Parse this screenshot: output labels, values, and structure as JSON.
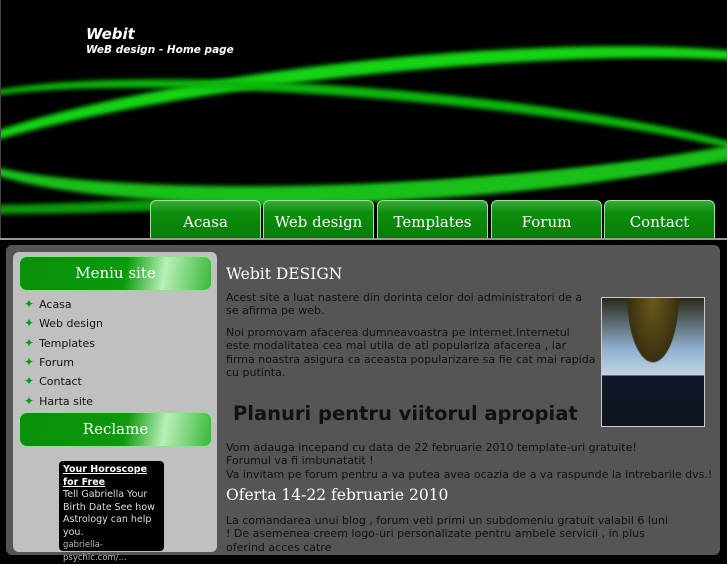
{
  "header": {
    "title": "Webit",
    "subtitle": "WeB design - Home page"
  },
  "nav": [
    "Acasa",
    "Web design",
    "Templates",
    "Forum",
    "Contact"
  ],
  "sidebar": {
    "menu_title": "Meniu site",
    "menu": [
      "Acasa",
      "Web design",
      "Templates",
      "Forum",
      "Contact",
      "Harta site"
    ],
    "ads_title": "Reclame",
    "ad": {
      "title": "Your Horoscope for Free",
      "text": "Tell Gabriella Your Birth Date See how Astrology can help you.",
      "url": "gabriella-psychic.com/..."
    }
  },
  "content": {
    "h1": "Webit DESIGN",
    "p1": "Acest site a luat nastere din dorinta celor doi administratori de a se afirma pe web.",
    "p2": "Noi promovam afacerea dumneavoastra pe internet.Internetul este modalitatea cea mai utila de ati populariza afacerea , iar firma noastra asigura ca aceasta popularizare sa fie cat mai rapida cu putinta.",
    "h2": "Planuri pentru viitorul apropiat",
    "lines": [
      "Vom adauga incepand cu data de 22 februarie 2010 template-uri gratuite!",
      "Forumul va fi imbunatatit !",
      "Va invitam pe forum pentru a va putea avea ocazia de a va raspunde la intrebarile dvs.!"
    ],
    "h3": "Oferta 14-22 februarie 2010",
    "p3": "La comandarea unui blog , forum veti primi un subdomeniu gratuit valabil 6 luni ! De asemenea creem logo-uri personalizate pentru ambele servicii , in plus oferind acces catre"
  }
}
